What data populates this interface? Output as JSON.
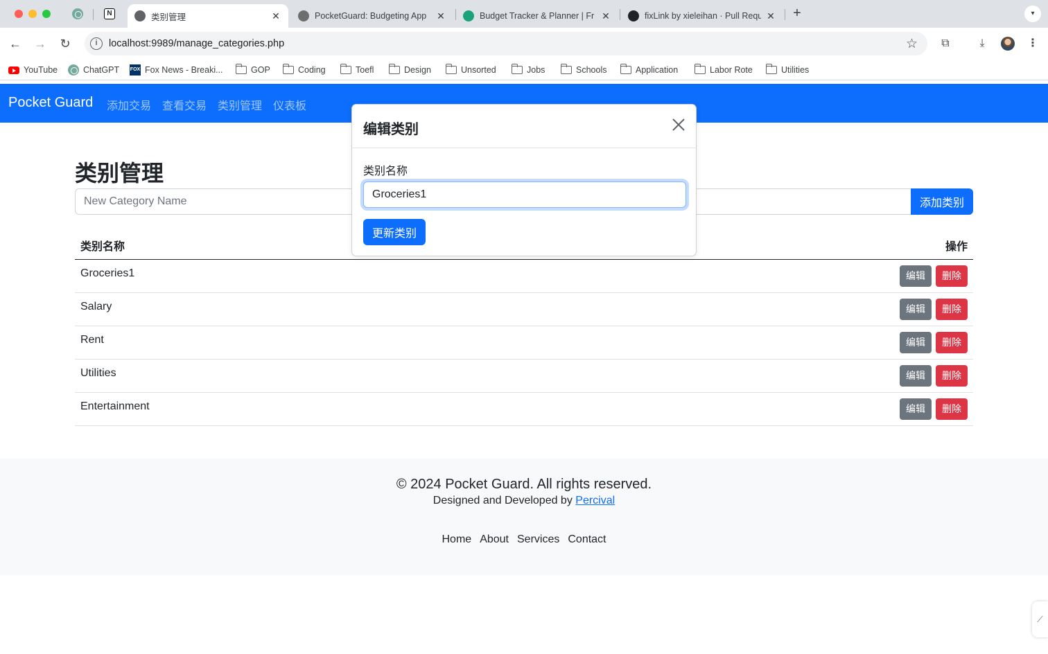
{
  "browser": {
    "tabs": [
      {
        "title": "类别管理",
        "active": true
      },
      {
        "title": "PocketGuard: Budgeting App",
        "active": false
      },
      {
        "title": "Budget Tracker & Planner | Fr",
        "active": false
      },
      {
        "title": "fixLink by xieleihan · Pull Requ",
        "active": false
      }
    ],
    "url": "localhost:9989/manage_categories.php",
    "bookmarks": [
      "YouTube",
      "ChatGPT",
      "Fox News - Breaki...",
      "GOP",
      "Coding",
      "Toefl",
      "Design",
      "Unsorted",
      "Jobs",
      "Schools",
      "Application",
      "Labor Rote",
      "Utilities"
    ],
    "fox_icon_text": "FOX"
  },
  "app": {
    "brand": "Pocket Guard",
    "nav": [
      "添加交易",
      "查看交易",
      "类别管理",
      "仪表板"
    ],
    "page_title": "类别管理",
    "new_category_placeholder": "New Category Name",
    "add_button": "添加类别",
    "table": {
      "headers": [
        "类别名称",
        "操作"
      ],
      "rows": [
        "Groceries1",
        "Salary",
        "Rent",
        "Utilities",
        "Entertainment"
      ],
      "edit_label": "编辑",
      "delete_label": "删除"
    }
  },
  "footer": {
    "copyright": "© 2024 Pocket Guard. All rights reserved.",
    "credit_prefix": "Designed and Developed by ",
    "credit_link": "Percival",
    "links": [
      "Home",
      "About",
      "Services",
      "Contact"
    ]
  },
  "modal": {
    "title": "编辑类别",
    "label": "类别名称",
    "value": "Groceries1",
    "submit": "更新类别"
  },
  "colors": {
    "primary": "#0d6efd",
    "secondary": "#6c757d",
    "danger": "#dc3545",
    "footer_bg": "#f8f9fa"
  }
}
